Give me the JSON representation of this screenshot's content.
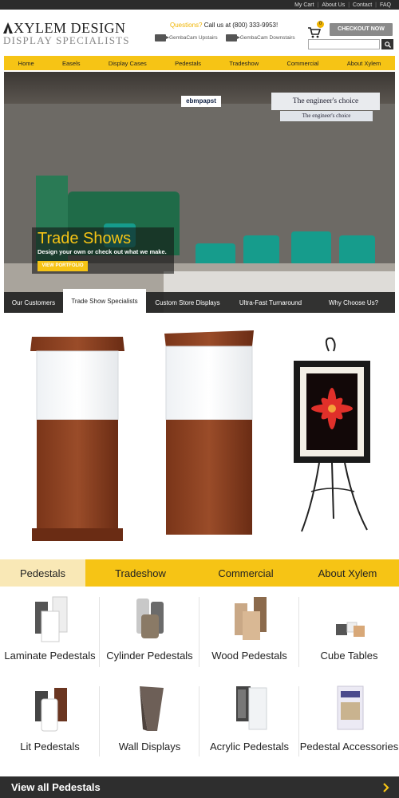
{
  "topbar": {
    "links": [
      "My Cart",
      "About Us",
      "Contact",
      "FAQ"
    ]
  },
  "header": {
    "logo_line1": "XYLEM DESIGN",
    "logo_line2": "DISPLAY SPECIALISTS",
    "questions": "Questions?",
    "call": " Call us at (800) 333-9953!",
    "cams": [
      "GembaCam Upstairs",
      "GembaCam Downstairs"
    ],
    "cart_count": "0",
    "checkout_label": "CHECKOUT NOW",
    "search_value": ""
  },
  "nav": {
    "items": [
      "Home",
      "Easels",
      "Display Cases",
      "Pedestals",
      "Tradeshow",
      "Commercial",
      "About Xylem"
    ]
  },
  "hero": {
    "sign1": "The engineer's choice",
    "sign2": "The engineer's choice",
    "brand": "ebmpapst",
    "title": "Trade Shows",
    "subtitle": "Design your own or check out what we make.",
    "button": "VIEW PORTFOLIO"
  },
  "subtabs": {
    "items": [
      "Our Customers",
      "Trade Show Specialists",
      "Custom Store Displays",
      "Ultra-Fast Turnaround",
      "Why Choose Us?"
    ],
    "active_index": 1
  },
  "categories": {
    "tabs": [
      "Pedestals",
      "Tradeshow",
      "Commercial",
      "About Xylem"
    ],
    "active_index": 0
  },
  "products": {
    "items": [
      "Laminate Pedestals",
      "Cylinder Pedestals",
      "Wood Pedestals",
      "Cube Tables",
      "Lit Pedestals",
      "Wall Displays",
      "Acrylic Pedestals",
      "Pedestal Accessories"
    ]
  },
  "footer": {
    "view_all": "View all Pedestals"
  },
  "colors": {
    "accent": "#f6c415",
    "dark": "#2e2e2e",
    "wood": "#8b3f22"
  }
}
